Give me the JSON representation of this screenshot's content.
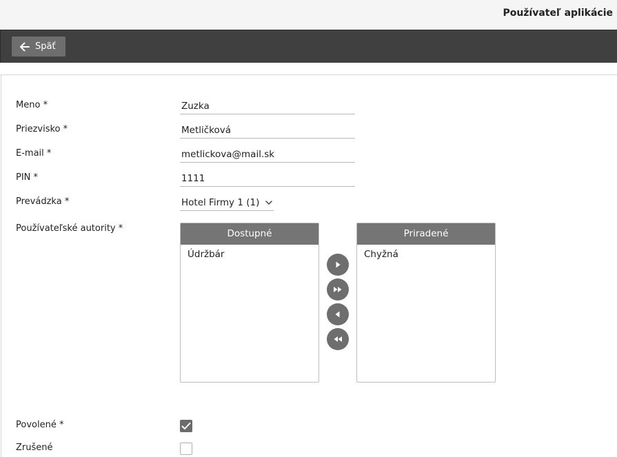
{
  "header": {
    "title": "Používateľ aplikácie"
  },
  "toolbar": {
    "back_label": "Späť"
  },
  "form": {
    "meno": {
      "label": "Meno",
      "value": "Zuzka"
    },
    "priezvisko": {
      "label": "Priezvisko",
      "value": "Metličková"
    },
    "email": {
      "label": "E-mail",
      "value": "metlickova@mail.sk"
    },
    "pin": {
      "label": "PIN",
      "value": "1111"
    },
    "prevadzka": {
      "label": "Prevádzka",
      "value": "Hotel Firmy 1 (1)"
    },
    "autority": {
      "label": "Používateľské autority",
      "available_title": "Dostupné",
      "assigned_title": "Priradené",
      "available": [
        "Údržbár"
      ],
      "assigned": [
        "Chyžná"
      ]
    },
    "povolene": {
      "label": "Povolené",
      "checked": true
    },
    "zrusene": {
      "label": "Zrušené",
      "checked": false
    },
    "required_mark": "*"
  },
  "colors": {
    "toolbar": "#404040",
    "button": "#6e6e6e",
    "list_header": "#757575"
  },
  "icons": {
    "back": "arrow-left-icon",
    "dropdown": "chevron-down-icon",
    "move_right": "play-icon",
    "move_all_right": "fast-forward-icon",
    "move_left": "play-left-icon",
    "move_all_left": "rewind-icon",
    "check": "check-icon"
  }
}
